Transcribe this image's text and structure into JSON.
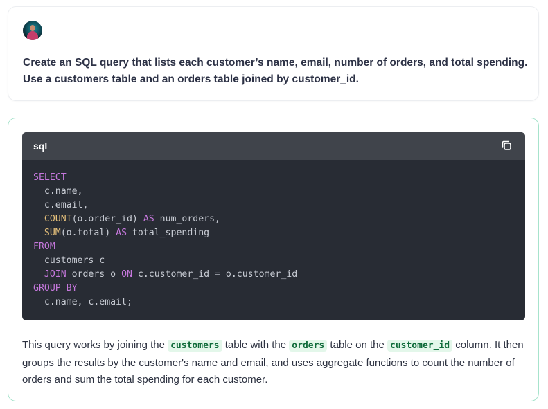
{
  "prompt": {
    "text": "Create an SQL query that lists each customer’s name, email, number of orders, and total spending. Use a customers table and an orders table joined by customer_id."
  },
  "code": {
    "language": "sql",
    "lines": [
      [
        {
          "t": "SELECT",
          "k": "kw"
        }
      ],
      [
        {
          "t": "  c.name,"
        }
      ],
      [
        {
          "t": "  c.email,"
        }
      ],
      [
        {
          "t": "  "
        },
        {
          "t": "COUNT",
          "k": "fn"
        },
        {
          "t": "(o.order_id) "
        },
        {
          "t": "AS",
          "k": "kw"
        },
        {
          "t": " num_orders,"
        }
      ],
      [
        {
          "t": "  "
        },
        {
          "t": "SUM",
          "k": "fn"
        },
        {
          "t": "(o.total) "
        },
        {
          "t": "AS",
          "k": "kw"
        },
        {
          "t": " total_spending"
        }
      ],
      [
        {
          "t": "FROM",
          "k": "kw"
        }
      ],
      [
        {
          "t": "  customers c"
        }
      ],
      [
        {
          "t": "  "
        },
        {
          "t": "JOIN",
          "k": "kw"
        },
        {
          "t": " orders o "
        },
        {
          "t": "ON",
          "k": "kw"
        },
        {
          "t": " c.customer_id = o.customer_id"
        }
      ],
      [
        {
          "t": "GROUP BY",
          "k": "kw"
        }
      ],
      [
        {
          "t": "  c.name, c.email;"
        }
      ]
    ]
  },
  "explanation": {
    "p1": "This query works by joining the ",
    "c1": "customers",
    "p2": " table with the ",
    "c2": "orders",
    "p3": " table on the ",
    "c3": "customer_id",
    "p4": " column. It then groups the results by the customer's name and email, and uses aggregate functions to count the number of orders and sum the total spending for each customer."
  },
  "colors": {
    "answer_border": "#a7e3cc",
    "code_bg": "#282c34",
    "code_header_bg": "#40444b",
    "keyword": "#c678dd",
    "function": "#e5c07b",
    "inline_code_bg": "#e3f7ea",
    "inline_code_fg": "#0f6b3a"
  },
  "icons": {
    "avatar": "user-avatar",
    "copy": "copy-icon"
  }
}
